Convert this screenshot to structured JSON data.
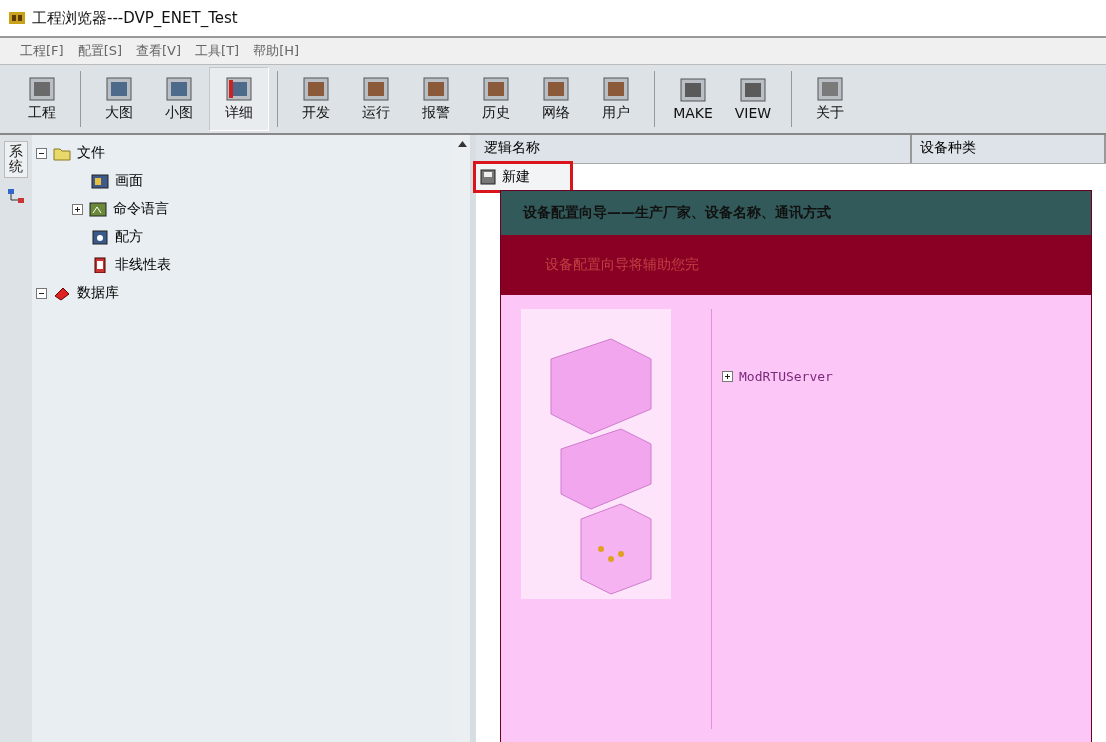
{
  "window": {
    "title": "工程浏览器---DVP_ENET_Test"
  },
  "menu": [
    "工程[F]",
    "配置[S]",
    "查看[V]",
    "工具[T]",
    "帮助[H]"
  ],
  "toolbar": [
    {
      "buttons": [
        {
          "label": "工程",
          "selected": false
        }
      ]
    },
    {
      "buttons": [
        {
          "label": "大图",
          "selected": false
        },
        {
          "label": "小图",
          "selected": false
        },
        {
          "label": "详细",
          "selected": true
        }
      ]
    },
    {
      "buttons": [
        {
          "label": "开发",
          "selected": false
        },
        {
          "label": "运行",
          "selected": false
        },
        {
          "label": "报警",
          "selected": false
        },
        {
          "label": "历史",
          "selected": false
        },
        {
          "label": "网络",
          "selected": false
        },
        {
          "label": "用户",
          "selected": false
        }
      ]
    },
    {
      "buttons": [
        {
          "label": "MAKE",
          "selected": false
        },
        {
          "label": "VIEW",
          "selected": false
        }
      ]
    },
    {
      "buttons": [
        {
          "label": "关于",
          "selected": false
        }
      ]
    }
  ],
  "side_tabs": [
    {
      "label": "系统",
      "selected": true
    }
  ],
  "tree": [
    {
      "label": "文件",
      "kind": "folder",
      "expanded": true,
      "children": [
        {
          "label": "画面",
          "kind": "screen"
        },
        {
          "label": "命令语言",
          "kind": "command",
          "expanded": false
        },
        {
          "label": "配方",
          "kind": "recipe"
        },
        {
          "label": "非线性表",
          "kind": "table"
        }
      ]
    },
    {
      "label": "数据库",
      "kind": "database",
      "expanded": true
    }
  ],
  "list": {
    "columns": [
      "逻辑名称",
      "设备种类"
    ],
    "rows": [
      {
        "name": "新建",
        "selected": true
      }
    ]
  },
  "dialog": {
    "title": "设备配置向导——生产厂家、设备名称、通讯方式",
    "intro": "设备配置向导将辅助您完",
    "tree": [
      {
        "label": "ModRTUServer",
        "expanded": false
      }
    ]
  }
}
